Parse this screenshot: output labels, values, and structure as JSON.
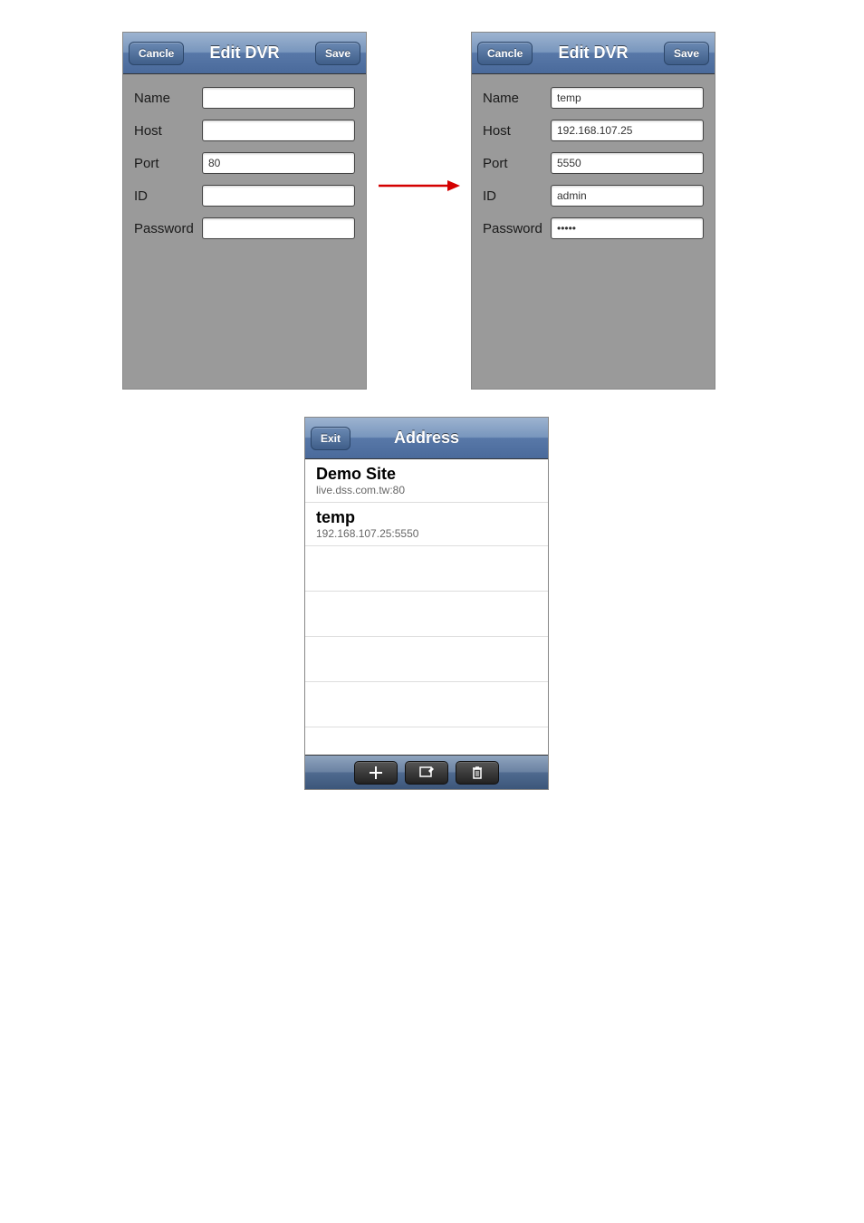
{
  "leftPanel": {
    "cancel": "Cancle",
    "title": "Edit DVR",
    "save": "Save",
    "labels": {
      "name": "Name",
      "host": "Host",
      "port": "Port",
      "id": "ID",
      "password": "Password"
    },
    "values": {
      "name": "",
      "host": "",
      "port": "80",
      "id": "",
      "password": ""
    }
  },
  "rightPanel": {
    "cancel": "Cancle",
    "title": "Edit DVR",
    "save": "Save",
    "labels": {
      "name": "Name",
      "host": "Host",
      "port": "Port",
      "id": "ID",
      "password": "Password"
    },
    "values": {
      "name": "temp",
      "host": "192.168.107.25",
      "port": "5550",
      "id": "admin",
      "password": "•••••"
    }
  },
  "addressPanel": {
    "exit": "Exit",
    "title": "Address",
    "items": [
      {
        "title": "Demo Site",
        "sub": "live.dss.com.tw:80"
      },
      {
        "title": "temp",
        "sub": "192.168.107.25:5550"
      }
    ]
  }
}
